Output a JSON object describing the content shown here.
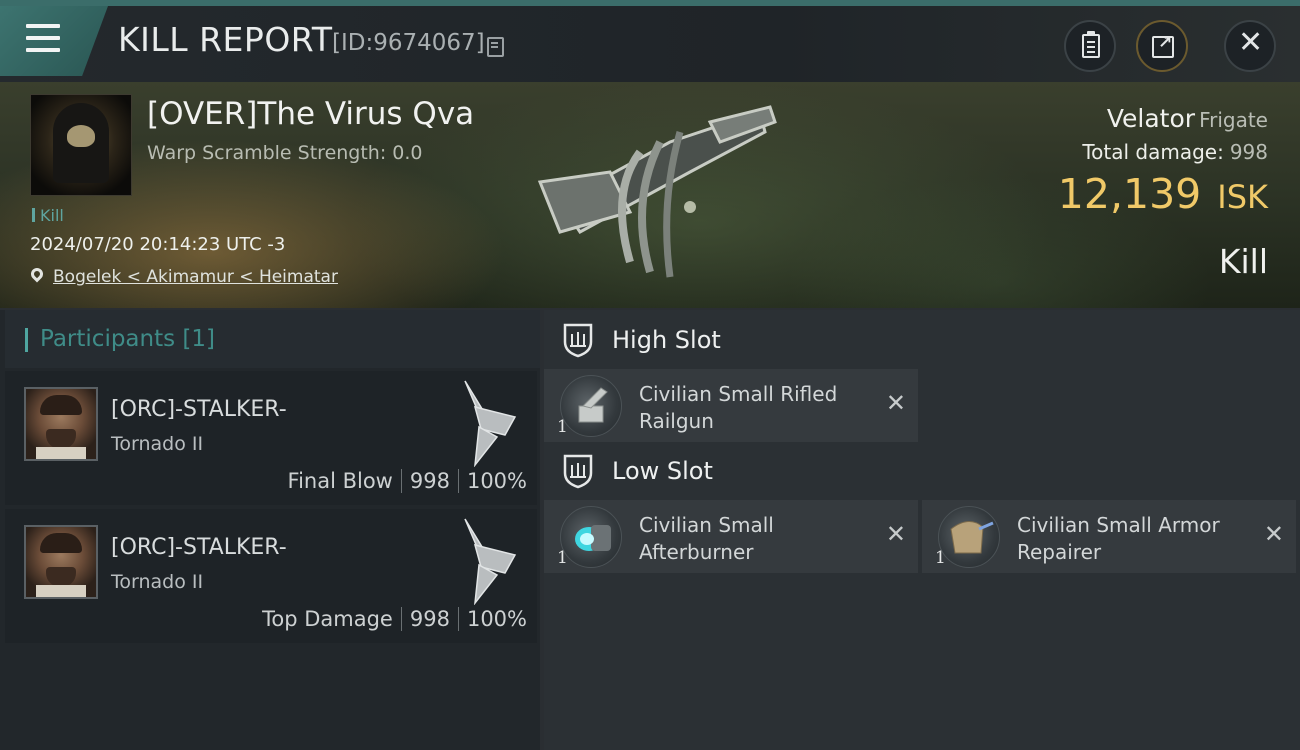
{
  "header": {
    "title": "KILL REPORT",
    "id_label": "[ID:9674067]"
  },
  "victim": {
    "name": "[OVER]The Virus Qva",
    "warp_scramble": "Warp Scramble Strength: 0.0",
    "tag": "Kill",
    "timestamp": "2024/07/20 20:14:23 UTC -3",
    "location": "Bogelek < Akimamur < Heimatar"
  },
  "ship": {
    "name": "Velator",
    "class": "Frigate",
    "total_damage_label": "Total damage:",
    "total_damage": "998",
    "isk_value": "12,139",
    "isk_unit": "ISK",
    "kill_type": "Kill"
  },
  "participants": {
    "title": "Participants [1]",
    "rows": [
      {
        "name": "[ORC]-STALKER-",
        "ship": "Tornado II",
        "role": "Final Blow",
        "damage": "998",
        "percent": "100%"
      },
      {
        "name": "[ORC]-STALKER-",
        "ship": "Tornado II",
        "role": "Top Damage",
        "damage": "998",
        "percent": "100%"
      }
    ]
  },
  "fitting": {
    "high_slot_label": "High Slot",
    "low_slot_label": "Low Slot",
    "high": [
      {
        "qty": "1",
        "name": "Civilian Small Rifled Railgun",
        "icon": "railgun-icon"
      }
    ],
    "low": [
      {
        "qty": "1",
        "name": "Civilian Small Afterburner",
        "icon": "afterburner-icon"
      },
      {
        "qty": "1",
        "name": "Civilian Small Armor Repairer",
        "icon": "armor-repairer-icon"
      }
    ]
  },
  "icons": {
    "menu": "hamburger-menu-icon",
    "copy": "copy-icon",
    "clipboard": "clipboard-icon",
    "share": "share-icon",
    "close": "close-icon",
    "location": "map-pin-icon",
    "slot": "shield-slot-icon",
    "remove": "x-icon"
  },
  "colors": {
    "accent": "#4fa6a0",
    "isk": "#f0c968",
    "panel_bg": "#22272b"
  }
}
